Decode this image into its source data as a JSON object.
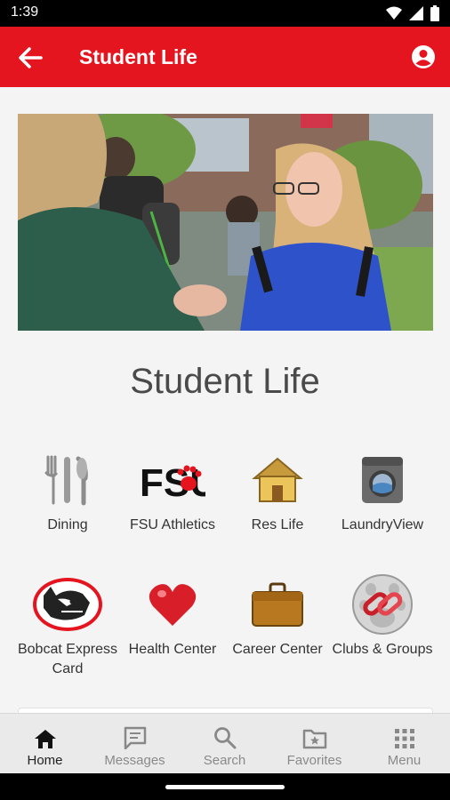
{
  "status_bar": {
    "time": "1:39"
  },
  "app_bar": {
    "title": "Student Life"
  },
  "page": {
    "heading": "Student Life"
  },
  "tiles": [
    {
      "label": "Dining",
      "icon": "utensils-icon"
    },
    {
      "label": "FSU Athletics",
      "icon": "fsu-logo-icon",
      "logo_text": "FSU"
    },
    {
      "label": "Res Life",
      "icon": "house-icon"
    },
    {
      "label": "LaundryView",
      "icon": "washer-icon"
    },
    {
      "label": "Bobcat Express Card",
      "icon": "bobcat-icon"
    },
    {
      "label": "Health Center",
      "icon": "heart-icon"
    },
    {
      "label": "Career Center",
      "icon": "briefcase-icon"
    },
    {
      "label": "Clubs & Groups",
      "icon": "chain-link-icon"
    }
  ],
  "bottom_nav": [
    {
      "label": "Home",
      "icon": "home-icon",
      "active": true
    },
    {
      "label": "Messages",
      "icon": "message-icon",
      "active": false
    },
    {
      "label": "Search",
      "icon": "search-icon",
      "active": false
    },
    {
      "label": "Favorites",
      "icon": "favorites-folder-icon",
      "active": false
    },
    {
      "label": "Menu",
      "icon": "grid-menu-icon",
      "active": false
    }
  ],
  "colors": {
    "brand_red": "#e4151f",
    "heading_gray": "#4a4a4a"
  }
}
